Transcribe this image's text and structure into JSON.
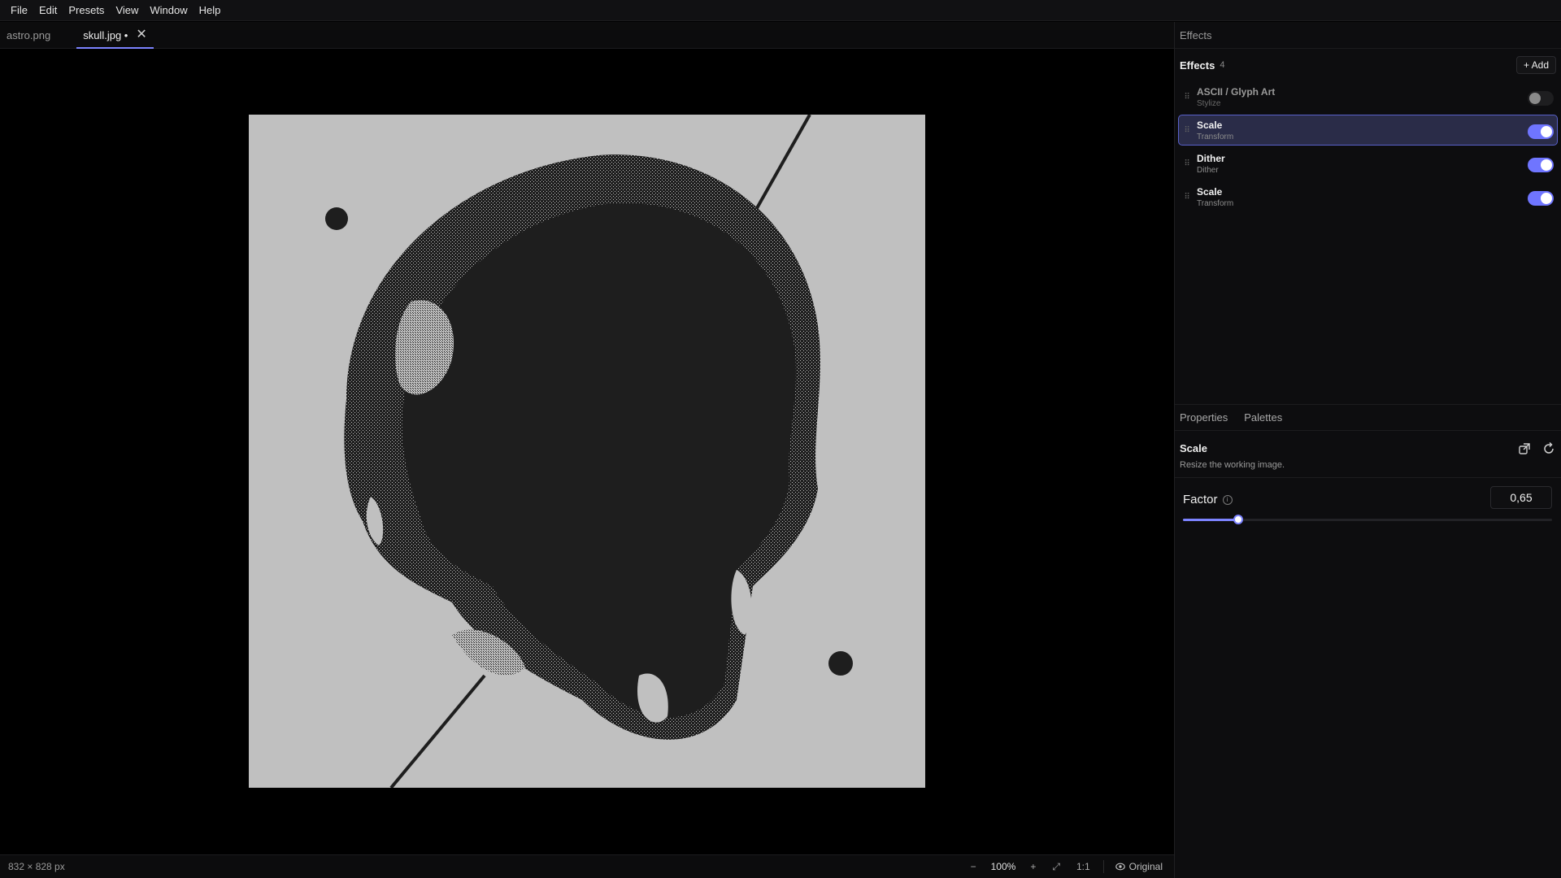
{
  "menu": [
    "File",
    "Edit",
    "Presets",
    "View",
    "Window",
    "Help"
  ],
  "tabs": [
    {
      "label": "astro.png",
      "active": false
    },
    {
      "label": "skull.jpg •",
      "active": true
    }
  ],
  "status": {
    "dimensions": "832 × 828 px",
    "zoom": "100%",
    "one_to_one": "1:1",
    "view_mode": "Original"
  },
  "panel": {
    "header": "Effects",
    "effects_title": "Effects",
    "effects_count": "4",
    "add_label": "Add",
    "effects": [
      {
        "name": "ASCII / Glyph Art",
        "category": "Stylize",
        "enabled": false,
        "selected": false
      },
      {
        "name": "Scale",
        "category": "Transform",
        "enabled": true,
        "selected": true
      },
      {
        "name": "Dither",
        "category": "Dither",
        "enabled": true,
        "selected": false
      },
      {
        "name": "Scale",
        "category": "Transform",
        "enabled": true,
        "selected": false
      }
    ],
    "props_tabs": [
      "Properties",
      "Palettes"
    ],
    "selected_effect": {
      "title": "Scale",
      "description": "Resize the working image.",
      "param_label": "Factor",
      "param_value": "0,65",
      "slider_fraction": 0.15
    }
  },
  "colors": {
    "accent": "#7c83ff",
    "image_background": "#c0c0c0",
    "image_dark": "#1e1e1e"
  }
}
